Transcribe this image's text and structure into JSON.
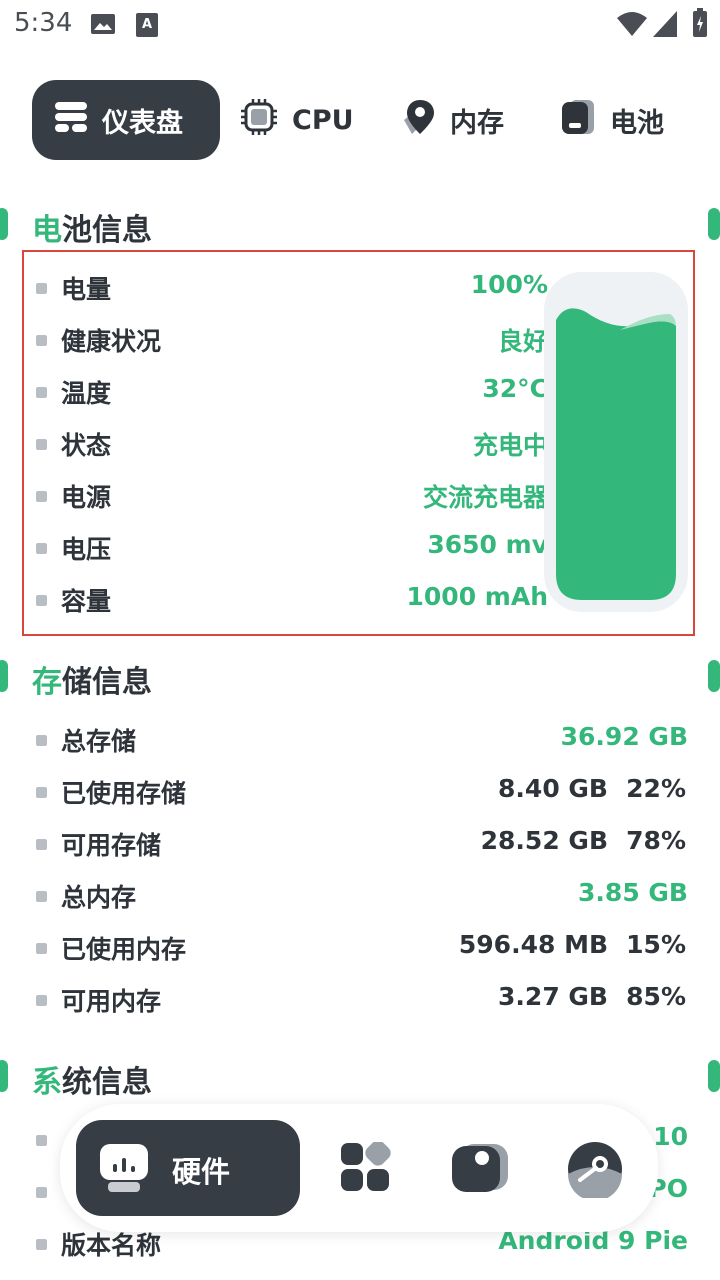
{
  "status_bar": {
    "time": "5:34",
    "icons": [
      "image-icon",
      "font-icon",
      "wifi-icon",
      "signal-icon",
      "battery-charging-icon"
    ]
  },
  "top_tabs": [
    {
      "label": "仪表盘",
      "icon": "dashboard-icon",
      "active": true
    },
    {
      "label": "CPU",
      "icon": "chip-icon",
      "active": false
    },
    {
      "label": "内存",
      "icon": "memory-icon",
      "active": false
    },
    {
      "label": "电池",
      "icon": "battery-icon",
      "active": false
    }
  ],
  "battery_section": {
    "title_accent": "电",
    "title_rest": "池信息",
    "rows": [
      {
        "label": "电量",
        "value": "100%"
      },
      {
        "label": "健康状况",
        "value": "良好"
      },
      {
        "label": "温度",
        "value": "32°C"
      },
      {
        "label": "状态",
        "value": "充电中"
      },
      {
        "label": "电源",
        "value": "交流充电器"
      },
      {
        "label": "电压",
        "value": "3650 mv"
      },
      {
        "label": "容量",
        "value": "1000 mAh"
      }
    ],
    "level_fraction": 1.0
  },
  "storage_section": {
    "title_accent": "存",
    "title_rest": "储信息",
    "rows": [
      {
        "label": "总存储",
        "value": "36.92 GB",
        "percent": ""
      },
      {
        "label": "已使用存储",
        "value": "8.40 GB",
        "percent": "22%"
      },
      {
        "label": "可用存储",
        "value": "28.52 GB",
        "percent": "78%"
      },
      {
        "label": "总内存",
        "value": "3.85 GB",
        "percent": ""
      },
      {
        "label": "已使用内存",
        "value": "596.48 MB",
        "percent": "15%"
      },
      {
        "label": "可用内存",
        "value": "3.27 GB",
        "percent": "85%"
      }
    ]
  },
  "system_section": {
    "title_accent": "系",
    "title_rest": "统信息",
    "rows": [
      {
        "label": "",
        "value": "10"
      },
      {
        "label": "",
        "value": "PO"
      },
      {
        "label": "版本名称",
        "value": "Android 9 Pie"
      }
    ]
  },
  "bottom_nav": {
    "active_label": "硬件",
    "items": [
      "hardware-icon",
      "apps-icon",
      "tag-icon",
      "disc-icon"
    ]
  },
  "colors": {
    "accent": "#34b77b",
    "dark": "#373d45",
    "highlight_border": "#d9463b"
  }
}
